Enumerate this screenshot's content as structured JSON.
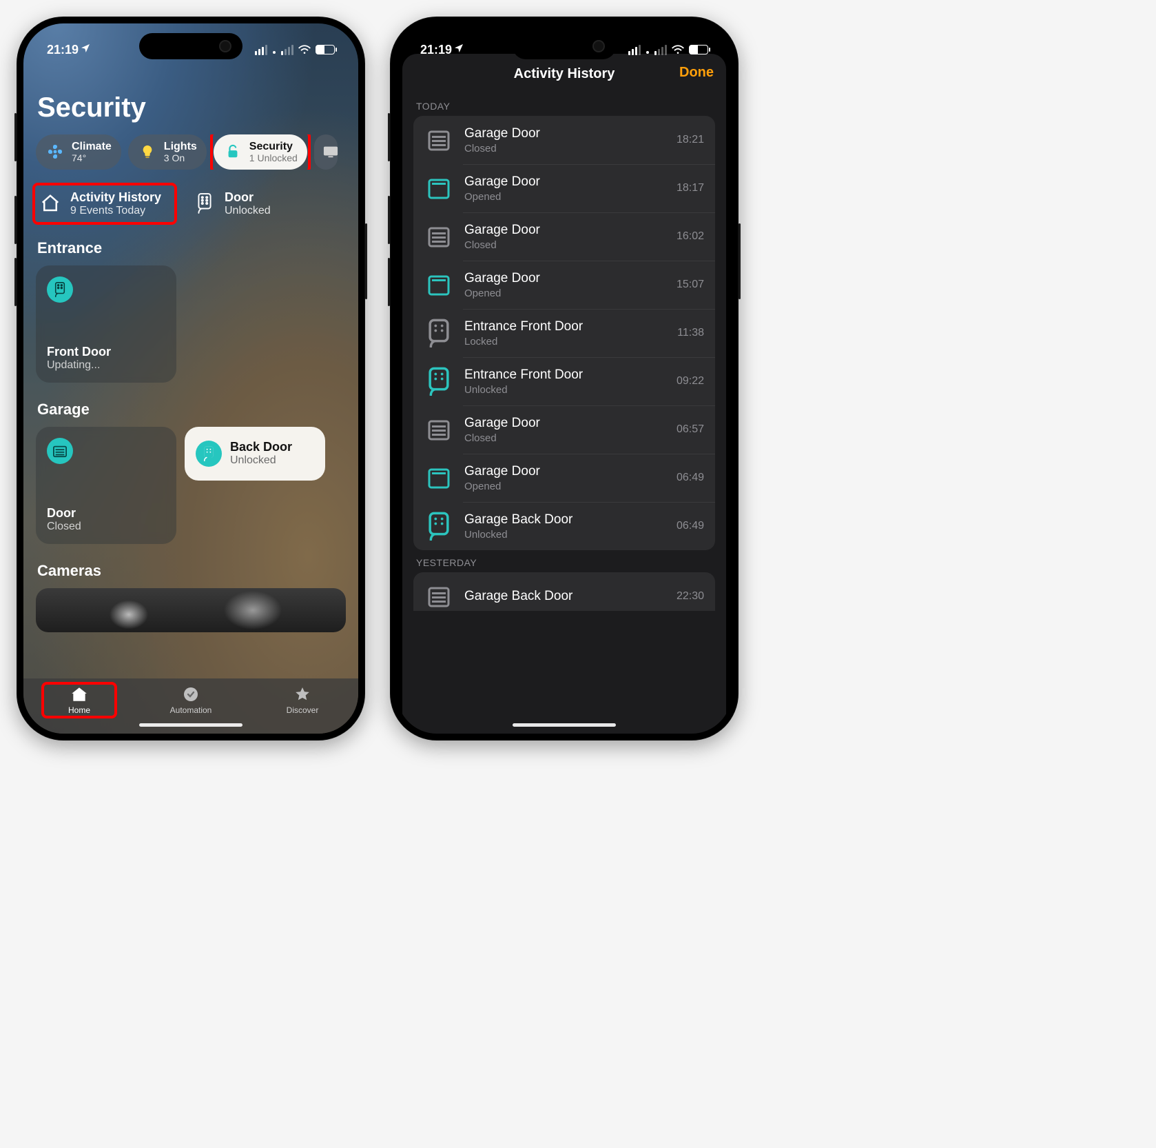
{
  "status": {
    "time": "21:19"
  },
  "colors": {
    "accent_teal": "#2cc4be",
    "accent_orange": "#ff9f0a",
    "highlight_red": "#ff0000"
  },
  "left": {
    "page_title": "Security",
    "chips": {
      "climate": {
        "title": "Climate",
        "sub": "74°"
      },
      "lights": {
        "title": "Lights",
        "sub": "3 On"
      },
      "security": {
        "title": "Security",
        "sub": "1 Unlocked"
      }
    },
    "activity_tile": {
      "title": "Activity History",
      "sub": "9 Events Today"
    },
    "door_tile": {
      "title": "Door",
      "sub": "Unlocked"
    },
    "sections": {
      "entrance": {
        "heading": "Entrance",
        "front_door": {
          "name": "Front Door",
          "state": "Updating..."
        }
      },
      "garage": {
        "heading": "Garage",
        "door": {
          "name": "Door",
          "state": "Closed"
        },
        "back_door": {
          "name": "Back Door",
          "state": "Unlocked"
        }
      },
      "cameras_heading": "Cameras"
    },
    "tabs": {
      "home": "Home",
      "automation": "Automation",
      "discover": "Discover"
    }
  },
  "right": {
    "sheet_title": "Activity History",
    "done_label": "Done",
    "groups": [
      {
        "label": "TODAY",
        "rows": [
          {
            "icon": "garage-closed",
            "name": "Garage Door",
            "state": "Closed",
            "time": "18:21"
          },
          {
            "icon": "garage-open",
            "name": "Garage Door",
            "state": "Opened",
            "time": "18:17"
          },
          {
            "icon": "garage-closed",
            "name": "Garage Door",
            "state": "Closed",
            "time": "16:02"
          },
          {
            "icon": "garage-open",
            "name": "Garage Door",
            "state": "Opened",
            "time": "15:07"
          },
          {
            "icon": "lock-locked",
            "name": "Entrance Front Door",
            "state": "Locked",
            "time": "11:38"
          },
          {
            "icon": "lock-unlocked",
            "name": "Entrance Front Door",
            "state": "Unlocked",
            "time": "09:22"
          },
          {
            "icon": "garage-closed",
            "name": "Garage Door",
            "state": "Closed",
            "time": "06:57"
          },
          {
            "icon": "garage-open",
            "name": "Garage Door",
            "state": "Opened",
            "time": "06:49"
          },
          {
            "icon": "lock-unlocked",
            "name": "Garage Back Door",
            "state": "Unlocked",
            "time": "06:49"
          }
        ]
      },
      {
        "label": "YESTERDAY",
        "rows": [
          {
            "icon": "garage-closed",
            "name": "Garage Back Door",
            "state": "",
            "time": "22:30"
          }
        ]
      }
    ]
  }
}
